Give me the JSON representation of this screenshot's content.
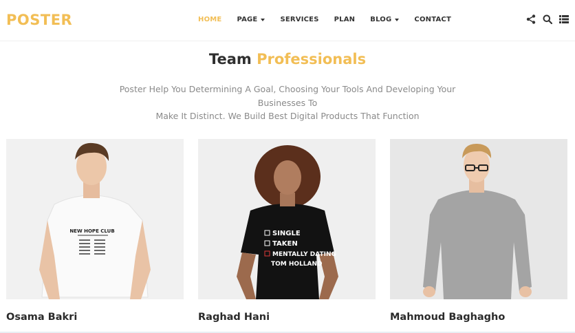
{
  "brand": {
    "logo": "POSTER",
    "accent_color": "#f2be55"
  },
  "nav": {
    "items": [
      {
        "label": "HOME",
        "active": true,
        "dropdown": false
      },
      {
        "label": "PAGE",
        "active": false,
        "dropdown": true
      },
      {
        "label": "SERVICES",
        "active": false,
        "dropdown": false
      },
      {
        "label": "PLAN",
        "active": false,
        "dropdown": false
      },
      {
        "label": "BLOG",
        "active": false,
        "dropdown": true
      },
      {
        "label": "CONTACT",
        "active": false,
        "dropdown": false
      }
    ],
    "icons": [
      "share-icon",
      "search-icon",
      "menu-list-icon"
    ]
  },
  "section": {
    "title_main": "Team",
    "title_accent": "Professionals",
    "subtitle_line1": "Poster Help You Determining A Goal, Choosing Your Tools And Developing Your Businesses To",
    "subtitle_line2": "Make It Distinct. We Build Best Digital Products That Function"
  },
  "team": [
    {
      "name": "Osama Bakri",
      "shirt_lines": [
        "NEW HOPE CLUB"
      ]
    },
    {
      "name": "Raghad Hani",
      "shirt_lines": [
        "SINGLE",
        "TAKEN",
        "MENTALLY DATING",
        "TOM HOLLAND"
      ]
    },
    {
      "name": "Mahmoud Baghagho",
      "shirt_lines": []
    }
  ]
}
